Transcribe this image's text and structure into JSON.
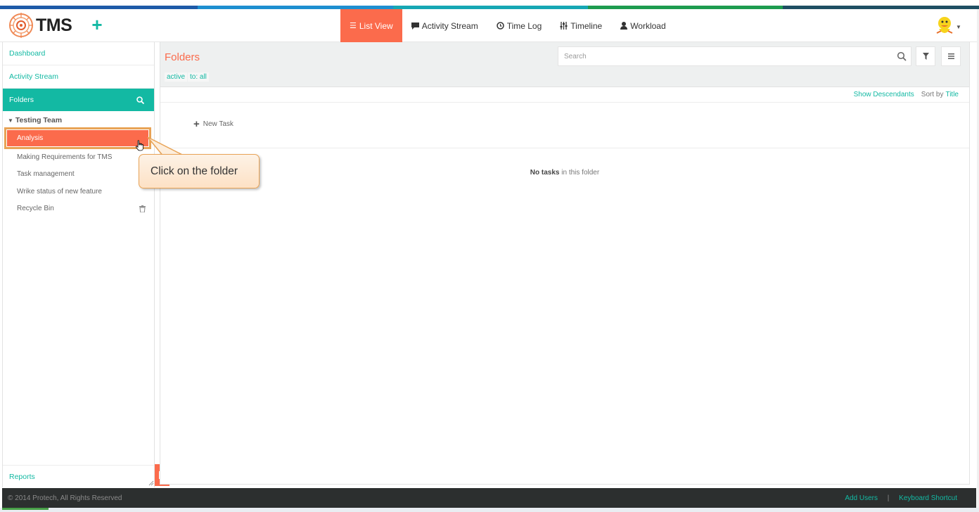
{
  "app": {
    "logo_text": "TMS"
  },
  "colors": {
    "accent": "#fb6b4c",
    "teal": "#13b9a3",
    "footer_bg": "#2c2f2f"
  },
  "nav": {
    "list_view": "List View",
    "activity_stream": "Activity Stream",
    "time_log": "Time Log",
    "timeline": "Timeline",
    "workload": "Workload"
  },
  "sidebar": {
    "dashboard": "Dashboard",
    "activity_stream": "Activity Stream",
    "folders": "Folders",
    "tree_root": "Testing Team",
    "items": [
      "Analysis",
      "Making Requirements for TMS",
      "Task management",
      "Wrike status of new feature",
      "Recycle Bin"
    ],
    "reports": "Reports"
  },
  "main": {
    "title": "Folders",
    "tags": [
      "active",
      "to: all"
    ],
    "search_placeholder": "Search",
    "show_descendants": "Show Descendants",
    "sort_by": "Sort by",
    "sort_field": "Title",
    "new_task": "New Task",
    "empty_bold": "No tasks",
    "empty_rest": " in this folder"
  },
  "callout": {
    "text": "Click on the folder"
  },
  "footer": {
    "copyright": "© 2014 Protech, All Rights Reserved",
    "add_users": "Add Users",
    "separator": "|",
    "keyboard_shortcut": "Keyboard Shortcut"
  }
}
